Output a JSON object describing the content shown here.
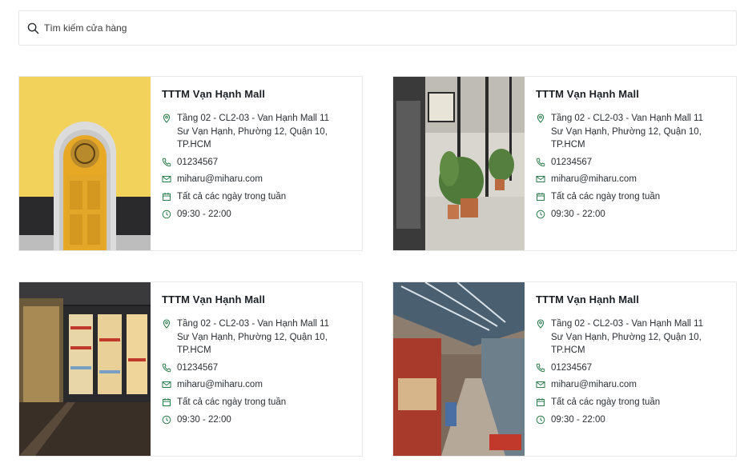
{
  "search": {
    "placeholder": "Tìm kiếm cửa hàng"
  },
  "stores": [
    {
      "name": "TTTM Vạn Hạnh Mall",
      "address": "Tầng 02 - CL2-03 - Van Hạnh Mall 11 Sư Vạn Hạnh, Phường 12, Quận 10, TP.HCM",
      "phone": "01234567",
      "email": "miharu@miharu.com",
      "days": "Tất cả các ngày trong tuần",
      "hours": "09:30 - 22:00",
      "image": "yellow-door"
    },
    {
      "name": "TTTM Vạn Hạnh Mall",
      "address": "Tầng 02 - CL2-03 - Van Hạnh Mall 11 Sư Vạn Hạnh, Phường 12, Quận 10, TP.HCM",
      "phone": "01234567",
      "email": "miharu@miharu.com",
      "days": "Tất cả các ngày trong tuần",
      "hours": "09:30 - 22:00",
      "image": "storefront-plants"
    },
    {
      "name": "TTTM Vạn Hạnh Mall",
      "address": "Tầng 02 - CL2-03 - Van Hạnh Mall 11 Sư Vạn Hạnh, Phường 12, Quận 10, TP.HCM",
      "phone": "01234567",
      "email": "miharu@miharu.com",
      "days": "Tất cả các ngày trong tuần",
      "hours": "09:30 - 22:00",
      "image": "supermarket-fridges"
    },
    {
      "name": "TTTM Vạn Hạnh Mall",
      "address": "Tầng 02 - CL2-03 - Van Hạnh Mall 11 Sư Vạn Hạnh, Phường 12, Quận 10, TP.HCM",
      "phone": "01234567",
      "email": "miharu@miharu.com",
      "days": "Tất cả các ngày trong tuần",
      "hours": "09:30 - 22:00",
      "image": "mall-interior"
    }
  ],
  "icons": {
    "search": "search-icon",
    "location": "location-pin-icon",
    "phone": "phone-icon",
    "email": "envelope-icon",
    "calendar": "calendar-icon",
    "clock": "clock-icon"
  },
  "colors": {
    "accent": "#2e7d4f",
    "border": "#e8e8e8"
  }
}
